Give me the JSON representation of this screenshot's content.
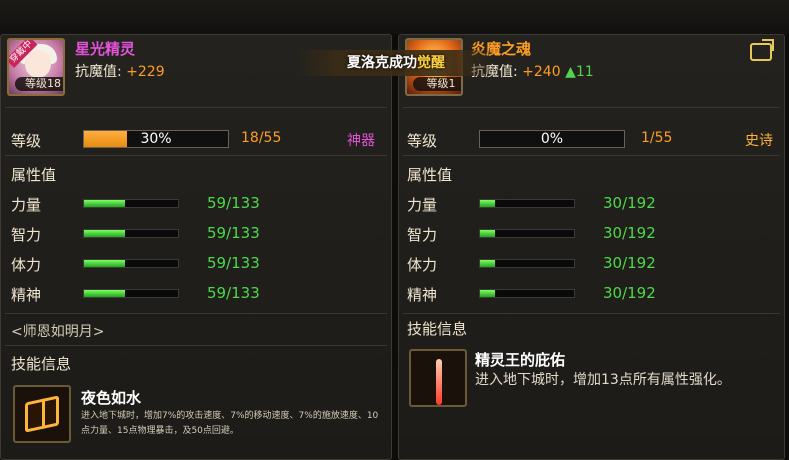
{
  "banner": {
    "text": "夏洛克成功",
    "highlight": "觉醒"
  },
  "left": {
    "name": "星光精灵",
    "resist_label": "抗魔值:",
    "resist_value": "+229",
    "portrait_level": "等级18",
    "equipped_tag": "穿戴中",
    "level_label": "等级",
    "level_percent": "30%",
    "level_fraction_value": 0.3,
    "level_count": "18/55",
    "grade": "神器",
    "attr_title": "属性值",
    "attrs": [
      {
        "label": "力量",
        "value": "59/133",
        "ratio": 0.44
      },
      {
        "label": "智力",
        "value": "59/133",
        "ratio": 0.44
      },
      {
        "label": "体力",
        "value": "59/133",
        "ratio": 0.44
      },
      {
        "label": "精神",
        "value": "59/133",
        "ratio": 0.44
      }
    ],
    "tagline": "<师恩如明月>",
    "skill_title": "技能信息",
    "skill_name": "夜色如水",
    "skill_desc": "进入地下城时，增加7%的攻击速度、7%的移动速度、7%的施放速度、10点力量、15点物理暴击，及50点回避。",
    "skill_icon": "book-icon"
  },
  "right": {
    "name": "炎魔之魂",
    "resist_label": "抗魔值:",
    "resist_value": "+240",
    "resist_up": "▲11",
    "portrait_level": "等级1",
    "level_label": "等级",
    "level_percent": "0%",
    "level_fraction_value": 0.0,
    "level_count": "1/55",
    "grade": "史诗",
    "attr_title": "属性值",
    "attrs": [
      {
        "label": "力量",
        "value": "30/192",
        "ratio": 0.16
      },
      {
        "label": "智力",
        "value": "30/192",
        "ratio": 0.16
      },
      {
        "label": "体力",
        "value": "30/192",
        "ratio": 0.16
      },
      {
        "label": "精神",
        "value": "30/192",
        "ratio": 0.16
      }
    ],
    "skill_title": "技能信息",
    "skill_name": "精灵王的庇佑",
    "skill_desc": "进入地下城时，增加13点所有属性强化。",
    "skill_icon": "light-beam-icon"
  },
  "colors": {
    "name": "#e153d8",
    "resist": "#ff9d22",
    "attr": "#4ed84a",
    "grade_artifact": "#e153d8",
    "grade_epic": "#ffb23a"
  }
}
